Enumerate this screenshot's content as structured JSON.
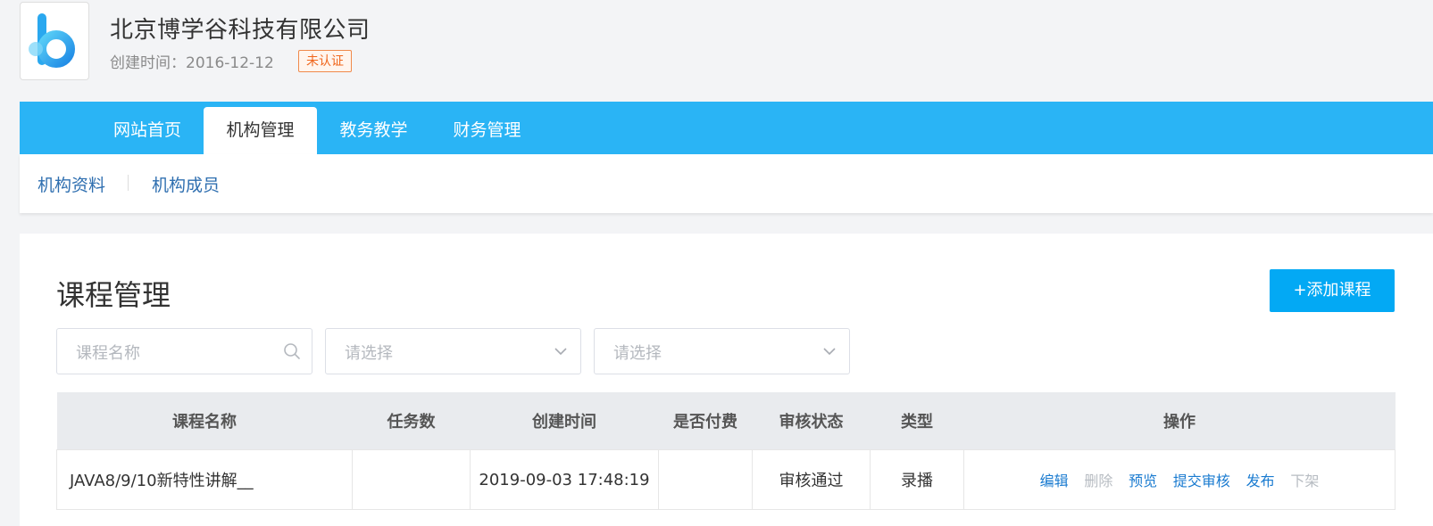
{
  "org": {
    "name": "北京博学谷科技有限公司",
    "created_label": "创建时间：",
    "created_date": "2016-12-12",
    "badge": "未认证"
  },
  "nav": {
    "tabs": [
      {
        "label": "网站首页",
        "active": false
      },
      {
        "label": "机构管理",
        "active": true
      },
      {
        "label": "教务教学",
        "active": false
      },
      {
        "label": "财务管理",
        "active": false
      }
    ]
  },
  "subnav": {
    "items": [
      {
        "label": "机构资料"
      },
      {
        "label": "机构成员"
      }
    ]
  },
  "main": {
    "title": "课程管理",
    "add_button": "+添加课程",
    "filters": {
      "name_placeholder": "课程名称",
      "select1_placeholder": "请选择",
      "select2_placeholder": "请选择"
    },
    "table": {
      "columns": [
        "课程名称",
        "任务数",
        "创建时间",
        "是否付费",
        "审核状态",
        "类型",
        "操作"
      ],
      "rows": [
        {
          "name": "JAVA8/9/10新特性讲解__",
          "tasks": "",
          "created": "2019-09-03 17:48:19",
          "paid": "",
          "status": "审核通过",
          "type": "录播",
          "actions": [
            {
              "label": "编辑",
              "enabled": true
            },
            {
              "label": "删除",
              "enabled": false
            },
            {
              "label": "预览",
              "enabled": true
            },
            {
              "label": "提交审核",
              "enabled": true
            },
            {
              "label": "发布",
              "enabled": true
            },
            {
              "label": "下架",
              "enabled": false
            }
          ]
        }
      ]
    }
  },
  "colors": {
    "nav_bg": "#2ab4f5",
    "button_bg": "#03a9f4",
    "link": "#1a7bd0",
    "badge": "#f0661c"
  },
  "icons": {
    "logo": "boxuegu-logo",
    "search": "search-icon",
    "dropdown": "chevron-down-icon"
  }
}
